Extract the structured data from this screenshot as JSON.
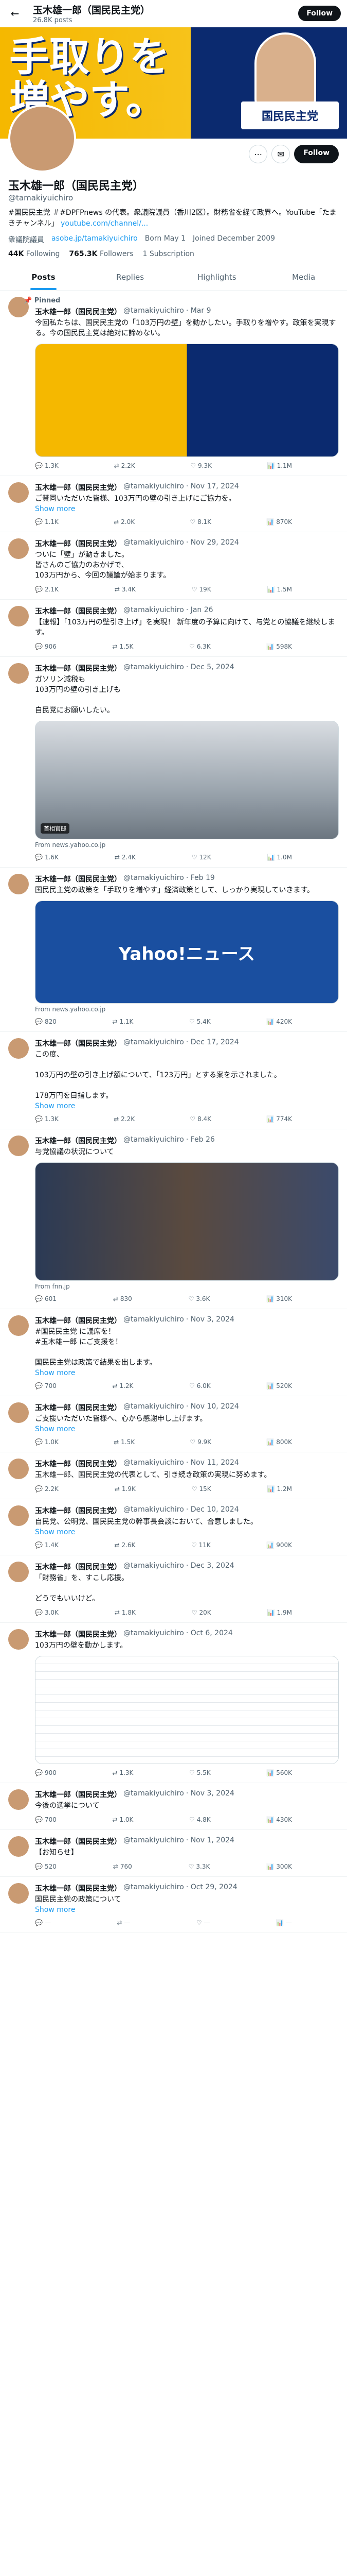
{
  "header": {
    "title": "玉木雄一郎（国民民主党）",
    "posts_count": "26.8K posts",
    "follow_label": "Follow"
  },
  "banner": {
    "headline": "手取りを増やす。",
    "brand": "国民民主党"
  },
  "profile": {
    "name": "玉木雄一郎（国民民主党）",
    "handle": "@tamakiyuichiro",
    "bio": "#国民民主党 ＃#DPFPnews の代表。衆議院議員（香川2区）。財務省を経て政界へ。YouTube「たまきチャンネル」",
    "website": "youtube.com/channel/...",
    "location": "衆議院議員",
    "website2": "asobe.jp/tamakiyuichiro",
    "born": "Born May 1",
    "joined": "Joined December 2009",
    "following": "44K",
    "following_label": "Following",
    "followers": "765.3K",
    "followers_label": "Followers",
    "subscription": "1 Subscription",
    "follow_label": "Follow"
  },
  "tabs": [
    "Posts",
    "Replies",
    "Highlights",
    "Media"
  ],
  "tweets": [
    {
      "pinned": "Pinned",
      "name": "玉木雄一郎（国民民主党）",
      "handle": "@tamakiyuichiro",
      "date": "Mar 9",
      "text": "今回私たちは、国民民主党の「103万円の壁」を動かしたい。手取りを増やす。政策を実現する。今の国民民主党は絶対に諦めない。",
      "show": "",
      "media": "banner",
      "replies": "1.3K",
      "reposts": "2.2K",
      "likes": "9.3K",
      "views": "1.1M"
    },
    {
      "pinned": "",
      "name": "玉木雄一郎（国民民主党）",
      "handle": "@tamakiyuichiro",
      "date": "Nov 17, 2024",
      "text": "ご賛同いただいた皆様、103万円の壁の引き上げにご協力を。",
      "show": "Show more",
      "media": "",
      "replies": "1.1K",
      "reposts": "2.0K",
      "likes": "8.1K",
      "views": "870K"
    },
    {
      "pinned": "",
      "name": "玉木雄一郎（国民民主党）",
      "handle": "@tamakiyuichiro",
      "date": "Nov 29, 2024",
      "text": "ついに「壁」が動きました。\n皆さんのご協力のおかげで、\n103万円から、今回の議論が始まります。",
      "show": "",
      "media": "",
      "replies": "2.1K",
      "reposts": "3.4K",
      "likes": "19K",
      "views": "1.5M"
    },
    {
      "pinned": "",
      "name": "玉木雄一郎（国民民主党）",
      "handle": "@tamakiyuichiro",
      "date": "Jan 26",
      "text": "【速報】「103万円の壁引き上げ」を実現！ 新年度の予算に向けて、与党との協議を継続します。",
      "show": "",
      "media": "",
      "replies": "906",
      "reposts": "1.5K",
      "likes": "6.3K",
      "views": "598K"
    },
    {
      "pinned": "",
      "name": "玉木雄一郎（国民民主党）",
      "handle": "@tamakiyuichiro",
      "date": "Dec 5, 2024",
      "text": "ガソリン減税も\n103万円の壁の引き上げも\n\n自民党にお願いしたい。",
      "show": "",
      "media": "building",
      "caption": "首相官邸",
      "card_source": "From news.yahoo.co.jp",
      "replies": "1.6K",
      "reposts": "2.4K",
      "likes": "12K",
      "views": "1.0M"
    },
    {
      "pinned": "",
      "name": "玉木雄一郎（国民民主党）",
      "handle": "@tamakiyuichiro",
      "date": "Feb 19",
      "text": "国民民主党の政策を「手取りを増やす」経済政策として、しっかり実現していきます。",
      "show": "",
      "media": "yahoo",
      "caption": "Yahoo!ニュース",
      "card_source": "From news.yahoo.co.jp",
      "replies": "820",
      "reposts": "1.1K",
      "likes": "5.4K",
      "views": "420K"
    },
    {
      "pinned": "",
      "name": "玉木雄一郎（国民民主党）",
      "handle": "@tamakiyuichiro",
      "date": "Dec 17, 2024",
      "text": "この度、\n\n103万円の壁の引き上げ額について、「123万円」とする案を示されました。\n\n178万円を目指します。",
      "show": "Show more",
      "media": "",
      "replies": "1.3K",
      "reposts": "2.2K",
      "likes": "8.4K",
      "views": "774K"
    },
    {
      "pinned": "",
      "name": "玉木雄一郎（国民民主党）",
      "handle": "@tamakiyuichiro",
      "date": "Feb 26",
      "text": "与党協議の状況について",
      "show": "",
      "media": "people",
      "card_source": "From fnn.jp",
      "replies": "601",
      "reposts": "830",
      "likes": "3.6K",
      "views": "310K"
    },
    {
      "pinned": "",
      "name": "玉木雄一郎（国民民主党）",
      "handle": "@tamakiyuichiro",
      "date": "Nov 3, 2024",
      "text": "#国民民主党 に議席を！\n#玉木雄一郎 にご支援を！\n\n国民民主党は政策で結果を出します。",
      "show": "Show more",
      "media": "",
      "replies": "700",
      "reposts": "1.2K",
      "likes": "6.0K",
      "views": "520K"
    },
    {
      "pinned": "",
      "name": "玉木雄一郎（国民民主党）",
      "handle": "@tamakiyuichiro",
      "date": "Nov 10, 2024",
      "text": "ご支援いただいた皆様へ、心から感謝申し上げます。",
      "show": "Show more",
      "media": "",
      "replies": "1.0K",
      "reposts": "1.5K",
      "likes": "9.9K",
      "views": "800K"
    },
    {
      "pinned": "",
      "name": "玉木雄一郎（国民民主党）",
      "handle": "@tamakiyuichiro",
      "date": "Nov 11, 2024",
      "text": "玉木雄一郎、国民民主党の代表として、引き続き政策の実現に努めます。",
      "show": "",
      "media": "",
      "replies": "2.2K",
      "reposts": "1.9K",
      "likes": "15K",
      "views": "1.2M"
    },
    {
      "pinned": "",
      "name": "玉木雄一郎（国民民主党）",
      "handle": "@tamakiyuichiro",
      "date": "Dec 10, 2024",
      "text": "自民党、公明党、国民民主党の幹事長会談において、合意しました。",
      "show": "Show more",
      "media": "",
      "replies": "1.4K",
      "reposts": "2.6K",
      "likes": "11K",
      "views": "900K"
    },
    {
      "pinned": "",
      "name": "玉木雄一郎（国民民主党）",
      "handle": "@tamakiyuichiro",
      "date": "Dec 3, 2024",
      "text": "「財務省」を、すこし応援。\n\nどうでもいいけど。",
      "show": "",
      "media": "",
      "replies": "3.0K",
      "reposts": "1.8K",
      "likes": "20K",
      "views": "1.9M"
    },
    {
      "pinned": "",
      "name": "玉木雄一郎（国民民主党）",
      "handle": "@tamakiyuichiro",
      "date": "Oct 6, 2024",
      "text": "103万円の壁を動かします。",
      "show": "",
      "media": "doc",
      "replies": "900",
      "reposts": "1.3K",
      "likes": "5.5K",
      "views": "560K"
    },
    {
      "pinned": "",
      "name": "玉木雄一郎（国民民主党）",
      "handle": "@tamakiyuichiro",
      "date": "Nov 3, 2024",
      "text": "今後の選挙について",
      "show": "",
      "media": "",
      "replies": "700",
      "reposts": "1.0K",
      "likes": "4.8K",
      "views": "430K"
    },
    {
      "pinned": "",
      "name": "玉木雄一郎（国民民主党）",
      "handle": "@tamakiyuichiro",
      "date": "Nov 1, 2024",
      "text": "【お知らせ】",
      "show": "",
      "media": "",
      "replies": "520",
      "reposts": "760",
      "likes": "3.3K",
      "views": "300K"
    },
    {
      "pinned": "",
      "name": "玉木雄一郎（国民民主党）",
      "handle": "@tamakiyuichiro",
      "date": "Oct 29, 2024",
      "text": "国民民主党の政策について",
      "show": "Show more",
      "media": "",
      "replies": "—",
      "reposts": "—",
      "likes": "—",
      "views": "—"
    }
  ]
}
